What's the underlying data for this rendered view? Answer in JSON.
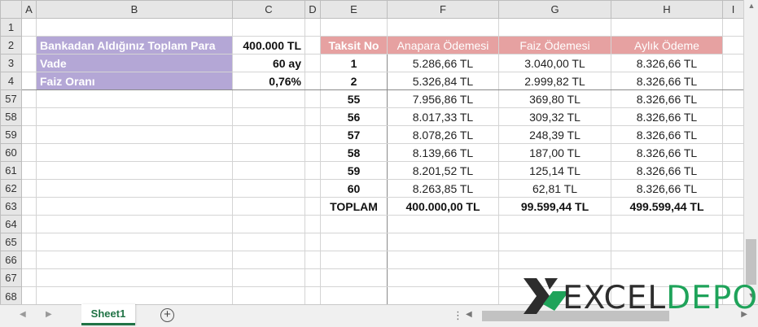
{
  "columns": [
    "A",
    "B",
    "C",
    "D",
    "E",
    "F",
    "G",
    "H",
    "I"
  ],
  "rows": [
    "1",
    "2",
    "3",
    "4",
    "57",
    "58",
    "59",
    "60",
    "61",
    "62",
    "63",
    "64",
    "65",
    "66",
    "67",
    "68"
  ],
  "loan": {
    "amount_label": "Bankadan Aldığınız Toplam Para",
    "amount_value": "400.000 TL",
    "term_label": "Vade",
    "term_value": "60 ay",
    "rate_label": "Faiz Oranı",
    "rate_value": "0,76%"
  },
  "table": {
    "headers": [
      "Taksit No",
      "Anapara Ödemesi",
      "Faiz Ödemesi",
      "Aylık Ödeme"
    ],
    "rows": [
      [
        "1",
        "5.286,66 TL",
        "3.040,00 TL",
        "8.326,66 TL"
      ],
      [
        "2",
        "5.326,84 TL",
        "2.999,82 TL",
        "8.326,66 TL"
      ],
      [
        "55",
        "7.956,86 TL",
        "369,80 TL",
        "8.326,66 TL"
      ],
      [
        "56",
        "8.017,33 TL",
        "309,32 TL",
        "8.326,66 TL"
      ],
      [
        "57",
        "8.078,26 TL",
        "248,39 TL",
        "8.326,66 TL"
      ],
      [
        "58",
        "8.139,66 TL",
        "187,00 TL",
        "8.326,66 TL"
      ],
      [
        "59",
        "8.201,52 TL",
        "125,14 TL",
        "8.326,66 TL"
      ],
      [
        "60",
        "8.263,85 TL",
        "62,81 TL",
        "8.326,66 TL"
      ]
    ],
    "total": [
      "TOPLAM",
      "400.000,00 TL",
      "99.599,44 TL",
      "499.599,44 TL"
    ]
  },
  "sheet_tab": "Sheet1",
  "add_sheet_symbol": "+",
  "watermark": {
    "part1": "EXCEL",
    "part2": "DEPO"
  },
  "colors": {
    "label_bg": "#b4a7d6",
    "header_bg": "#e6a1a1",
    "tab_accent": "#217346",
    "brand_green": "#1fa35a"
  }
}
